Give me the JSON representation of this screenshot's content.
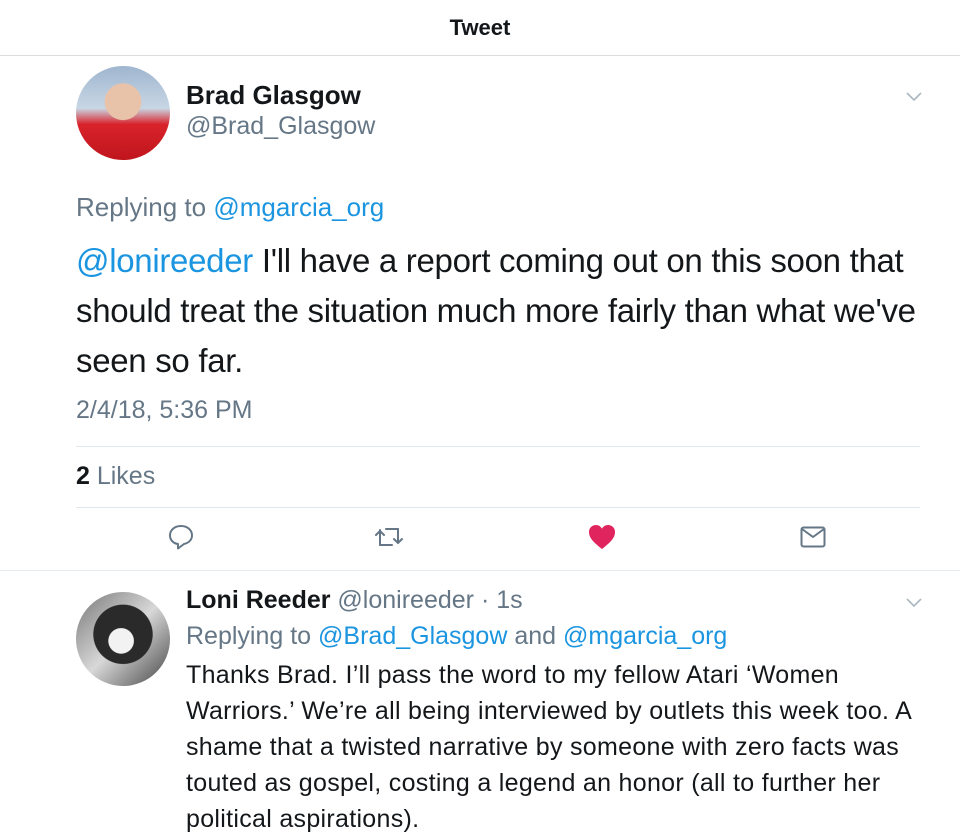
{
  "header": {
    "title": "Tweet"
  },
  "tweet": {
    "author_name": "Brad Glasgow",
    "author_handle": "@Brad_Glasgow",
    "replying_prefix": "Replying to ",
    "replying_to": "@mgarcia_org",
    "mention": "@lonireeder",
    "text": " I'll have a report coming out on this soon that should treat the situation much more fairly than what we've seen so far.",
    "timestamp": "2/4/18, 5:36 PM",
    "likes_count": "2",
    "likes_label": " Likes"
  },
  "actions": {
    "reply_icon": "reply-icon",
    "retweet_icon": "retweet-icon",
    "like_icon": "heart-icon",
    "share_icon": "mail-icon",
    "like_color": "#e0245e"
  },
  "reply": {
    "author_name": "Loni Reeder",
    "author_handle": " @lonireeder",
    "time": " · 1s",
    "replying_prefix": "Replying to ",
    "replying_to_1": "@Brad_Glasgow",
    "replying_and": " and ",
    "replying_to_2": "@mgarcia_org",
    "text": "Thanks Brad. I’ll pass the word to my fellow Atari ‘Women Warriors.’ We’re all being interviewed by outlets this week too. A shame that a twisted narrative by someone with zero facts was touted as gospel, costing a legend an honor (all to further her political aspirations)."
  },
  "colors": {
    "link": "#1b95e0",
    "secondary": "#657786",
    "text": "#14171a"
  }
}
